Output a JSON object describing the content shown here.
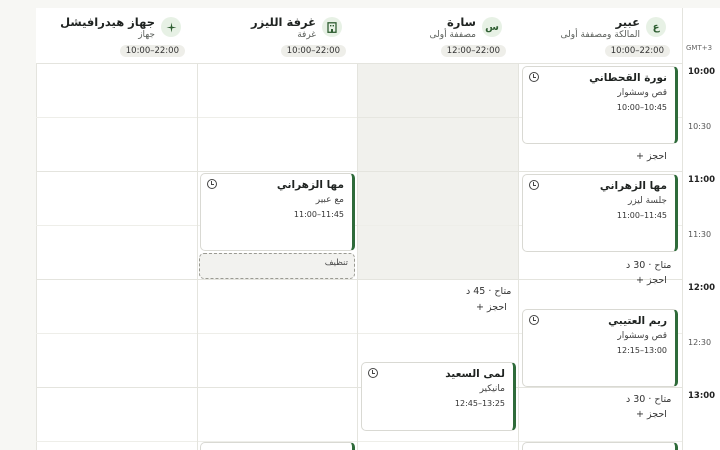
{
  "timezone": "GMT+3",
  "columns": [
    {
      "name": "عبير",
      "role": "المالكة ومصففة أولى",
      "hours": "10:00–22:00",
      "avatar": "ع"
    },
    {
      "name": "سارة",
      "role": "مصففة أولى",
      "hours": "12:00–22:00",
      "avatar": "س"
    },
    {
      "name": "غرفة الليزر",
      "role": "غرفة",
      "hours": "10:00–22:00",
      "avatar": "building-icon"
    },
    {
      "name": "جهاز هيدرافيشل",
      "role": "جهاز",
      "hours": "10:00–22:00",
      "avatar": "sparkle-icon"
    }
  ],
  "times": {
    "t1000": "10:00",
    "t1030": "10:30",
    "t1100": "11:00",
    "t1130": "11:30",
    "t1200": "12:00",
    "t1230": "12:30",
    "t1300": "13:00"
  },
  "appointments": [
    {
      "client": "نورة القحطاني",
      "service": "قص وسشوار",
      "time": "10:00–10:45"
    },
    {
      "client": "مها الزهراني",
      "service": "جلسة ليزر",
      "time": "11:00–11:45"
    },
    {
      "client": "ريم العتيبي",
      "service": "قص وسشوار",
      "time": "12:15–13:00"
    },
    {
      "client": "مها الزهراني",
      "service": "مع عبير",
      "time": "11:00–11:45"
    },
    {
      "client": "لمى السعيد",
      "service": "مانيكير",
      "time": "12:45–13:25"
    }
  ],
  "cleanup_label": "تنظيف",
  "book_label": "احجز",
  "book_plus": "+",
  "avail": {
    "a30": "متاح · 30 د",
    "a45": "متاح · 45 د",
    "b30": "متاح · 30 د"
  }
}
